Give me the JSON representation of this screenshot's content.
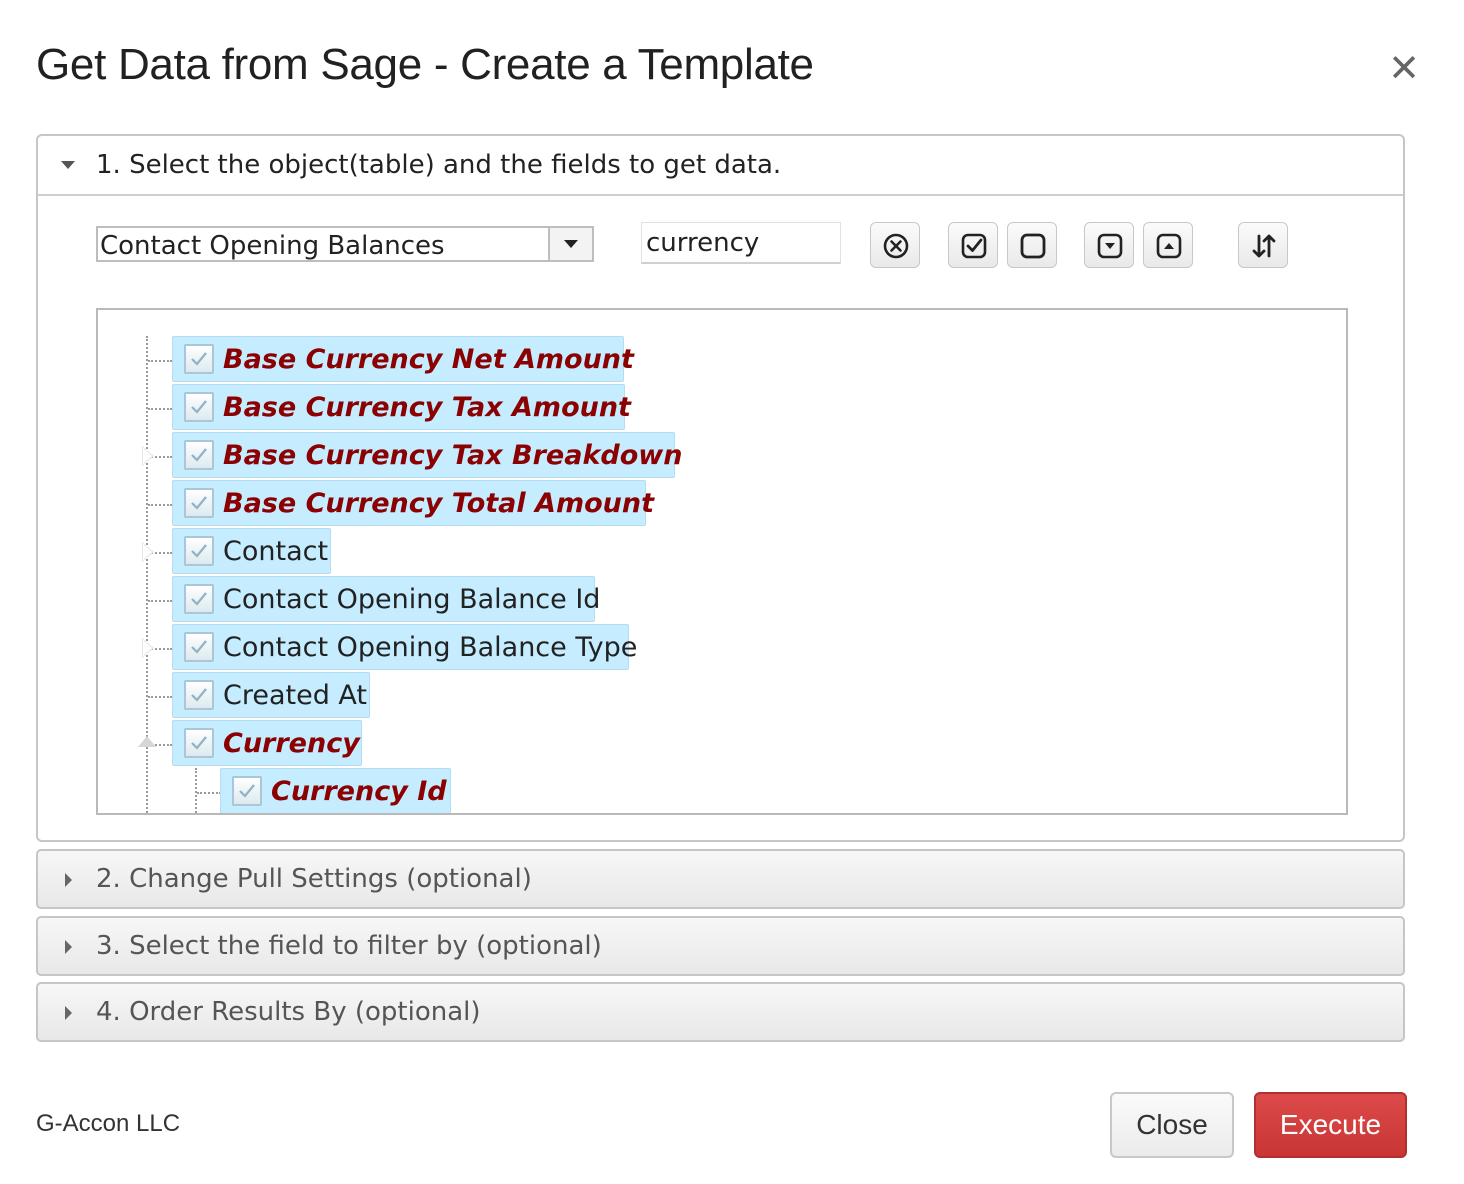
{
  "dialog": {
    "title": "Get Data from Sage - Create a Template",
    "close_icon": "close-x-icon"
  },
  "step1": {
    "label": "1. Select the object(table) and the fields to get data.",
    "object_value": "Contact Opening Balances",
    "search_value": "currency",
    "toolbar_icons": [
      "clear-search-icon",
      "check-all-icon",
      "uncheck-all-icon",
      "expand-all-icon",
      "collapse-all-icon",
      "sort-icon"
    ],
    "tree": [
      {
        "label": "Base Currency Net Amount",
        "highlight": true,
        "checked": true
      },
      {
        "label": "Base Currency Tax Amount",
        "highlight": true,
        "checked": true
      },
      {
        "label": "Base Currency Tax Breakdown",
        "highlight": true,
        "checked": true,
        "expandable": true
      },
      {
        "label": "Base Currency Total Amount",
        "highlight": true,
        "checked": true
      },
      {
        "label": "Contact",
        "highlight": false,
        "checked": true,
        "expandable": true
      },
      {
        "label": "Contact Opening Balance Id",
        "highlight": false,
        "checked": true
      },
      {
        "label": "Contact Opening Balance Type",
        "highlight": false,
        "checked": true,
        "expandable": true
      },
      {
        "label": "Created At",
        "highlight": false,
        "checked": true
      },
      {
        "label": "Currency",
        "highlight": true,
        "checked": true,
        "expanded": true
      },
      {
        "label": "Currency Id",
        "highlight": true,
        "checked": true,
        "child": true
      }
    ]
  },
  "step2": {
    "label": "2. Change Pull Settings (optional)"
  },
  "step3": {
    "label": "3. Select the field to filter by (optional)"
  },
  "step4": {
    "label": "4. Order Results By (optional)"
  },
  "footer": {
    "brand": "G-Accon LLC",
    "close_label": "Close",
    "execute_label": "Execute"
  },
  "colors": {
    "highlight_text": "#8b0000",
    "node_bg": "#c5ecff",
    "execute_bg": "#d23f3f"
  }
}
